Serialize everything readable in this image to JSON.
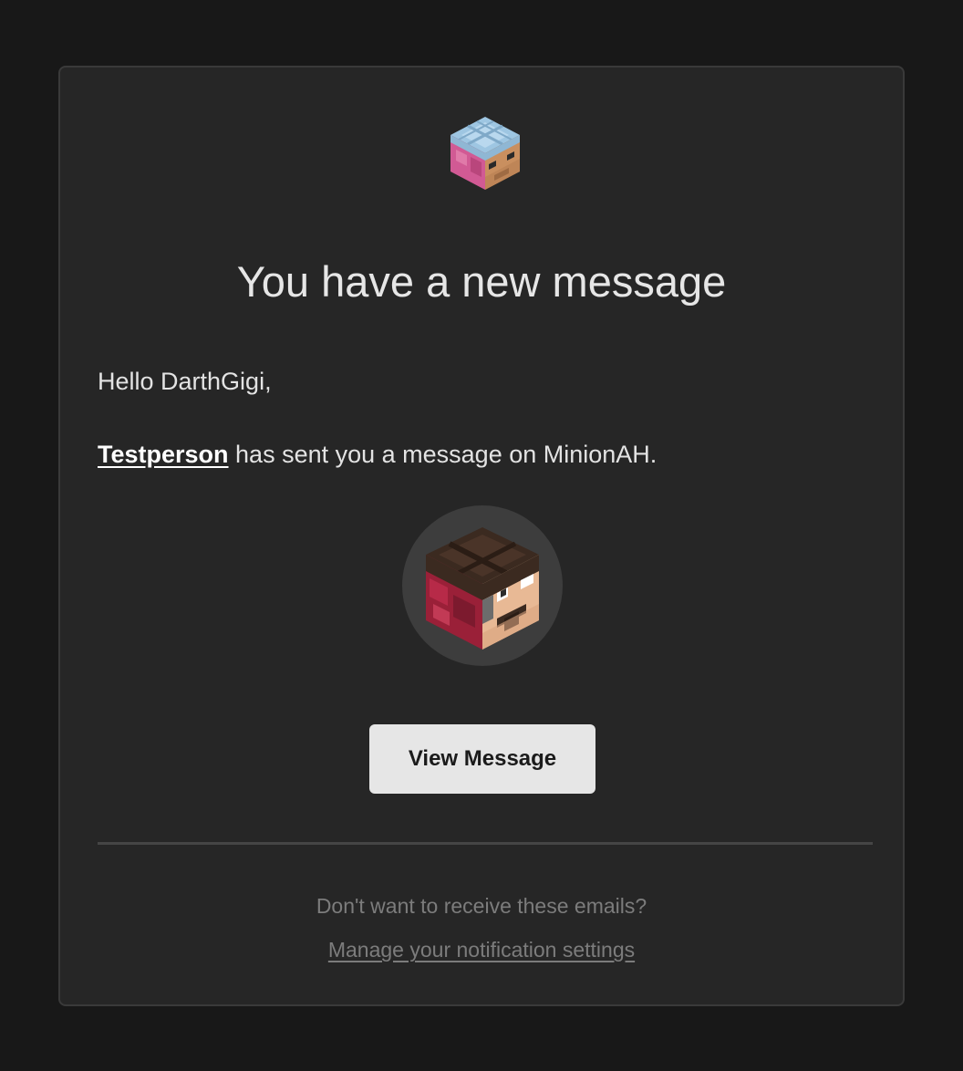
{
  "header": {
    "logo_icon": "minion-head-icon"
  },
  "email": {
    "title": "You have a new message",
    "greeting": "Hello DarthGigi,",
    "sender": "Testperson",
    "message_suffix": " has sent you a message on MinionAH.",
    "avatar_icon": "player-head-icon",
    "button_label": "View Message"
  },
  "footer": {
    "unsubscribe_question": "Don't want to receive these emails?",
    "manage_settings_label": "Manage your notification settings"
  },
  "colors": {
    "page_background": "#181818",
    "card_background": "#262626",
    "button_background": "#e6e6e6",
    "muted_text": "#7c7c7c"
  }
}
